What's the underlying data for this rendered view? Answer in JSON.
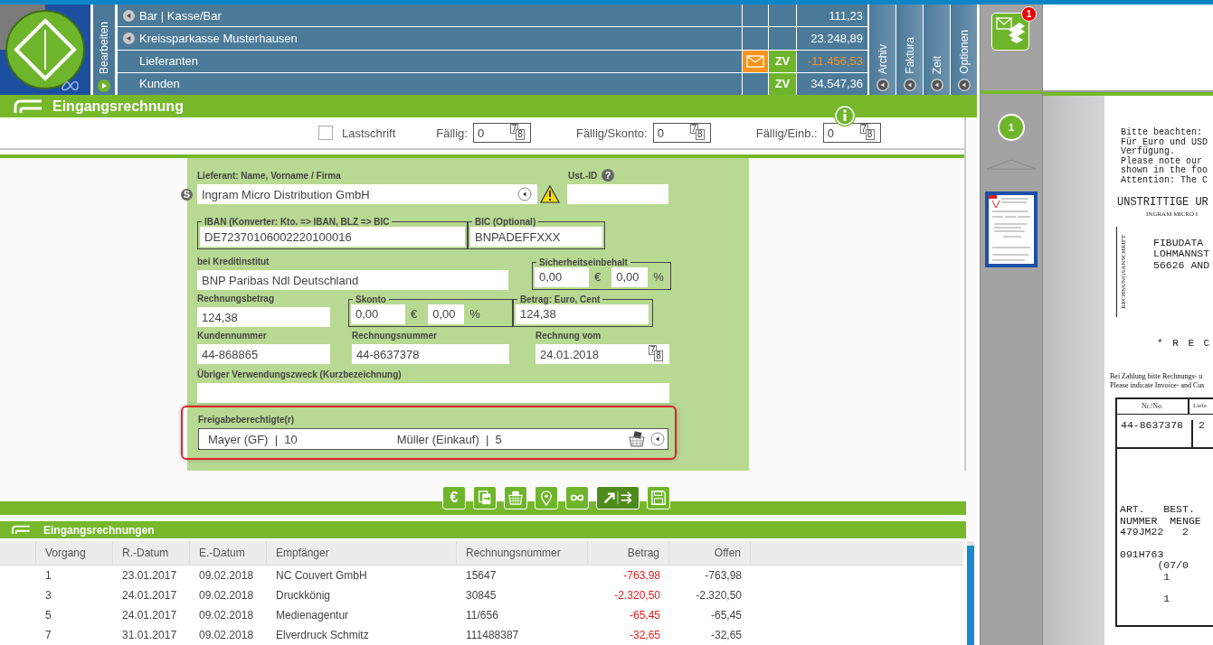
{
  "menu_tab": {
    "label": "Bearbeiten"
  },
  "accounts": [
    {
      "name": "Bar | Kasse/Bar",
      "expandable": true,
      "mail": false,
      "amount": "111,23",
      "negative": false
    },
    {
      "name": "Kreissparkasse Musterhausen",
      "expandable": true,
      "mail": false,
      "amount": "23.248,89",
      "negative": false
    },
    {
      "name": "Lieferanten",
      "expandable": false,
      "mail": true,
      "zv": "ZV",
      "amount": "-11.456,53",
      "negative": true
    },
    {
      "name": "Kunden",
      "expandable": false,
      "mail": false,
      "zv": "ZV",
      "amount": "34.547,36",
      "negative": false
    }
  ],
  "side_tabs": [
    {
      "label": "Archiv"
    },
    {
      "label": "Faktura"
    },
    {
      "label": "Zeit"
    },
    {
      "label": "Optionen"
    }
  ],
  "title": "Eingangsrechnung",
  "filters": {
    "direct_debit": {
      "label": "Lastschrift",
      "checked": false
    },
    "due_dates": [
      {
        "label": "Fällig:",
        "value": "0",
        "calendar": [
          "7",
          "8"
        ]
      },
      {
        "label": "Fällig/Skonto:",
        "value": "0",
        "calendar": [
          "7",
          "8"
        ]
      },
      {
        "label": "Fällig/Einb.:",
        "value": "0",
        "calendar": [
          "7",
          "8"
        ]
      }
    ]
  },
  "form": {
    "supplier": {
      "label": "Lieferant: Name, Vorname / Firma",
      "badge": "S",
      "value": "Ingram Micro Distribution GmbH",
      "warning": true
    },
    "vat_id": {
      "label": "Ust.-ID",
      "help": "?"
    },
    "iban": {
      "label": "IBAN (Konverter: Kto. => IBAN, BLZ => BIC",
      "value": "DE72370106002220100016"
    },
    "bic": {
      "label": "BIC (Optional)",
      "value": "BNPADEFFXXX"
    },
    "bank": {
      "label": "bei Kreditinstitut",
      "value": "BNP Paribas Ndl Deutschland"
    },
    "retention": {
      "label": "Sicherheitseinbehalt",
      "amount": "0,00",
      "currency": "€",
      "percent": "0,00",
      "percent_sign": "%"
    },
    "invoice_amount": {
      "label": "Rechnungsbetrag",
      "value": "124,38"
    },
    "discount": {
      "label": "Skonto",
      "amount": "0,00",
      "currency": "€",
      "percent": "0,00",
      "percent_sign": "%"
    },
    "amount": {
      "label": "Betrag: Euro, Cent",
      "value": "124,38"
    },
    "customer_number": {
      "label": "Kundennummer",
      "value": "44-868865"
    },
    "invoice_number": {
      "label": "Rechnungsnummer",
      "value": "44-8637378"
    },
    "invoice_date": {
      "label": "Rechnung vom",
      "value": "24.01.2018",
      "calendar": [
        "7",
        "8"
      ]
    },
    "purpose": {
      "label": "Übriger Verwendungszweck (Kurzbezeichnung)"
    },
    "approvers": {
      "label": "Freigabeberechtigte(r)",
      "highlighted": true,
      "entries": [
        "Mayer (GF)  |  10",
        "Müller (Einkauf)  |  5"
      ]
    }
  },
  "toolbar": [
    {
      "kind": "euro",
      "glyph": "€",
      "selected": false
    },
    {
      "kind": "copy",
      "selected": false
    },
    {
      "kind": "basket",
      "selected": false
    },
    {
      "kind": "pin",
      "selected": false
    },
    {
      "kind": "infinity",
      "selected": false
    },
    {
      "kind": "transfer",
      "selected": true
    },
    {
      "kind": "save",
      "selected": false
    }
  ],
  "list": {
    "title": "Eingangsrechnungen",
    "columns": [
      "Vorgang",
      "R.-Datum",
      "E.-Datum",
      "Empfänger",
      "Rechnungsnummer",
      "Betrag",
      "Offen"
    ],
    "rows": [
      {
        "cells": [
          "1",
          "23.01.2017",
          "09.02.2018",
          "NC Couvert GmbH",
          "15647",
          "-763,98",
          "-763,98"
        ],
        "negative": true
      },
      {
        "cells": [
          "3",
          "24.01.2017",
          "09.02.2018",
          "Druckkönig",
          "30845",
          "-2.320,50",
          "-2.320,50"
        ],
        "negative": true
      },
      {
        "cells": [
          "5",
          "24.01.2017",
          "09.02.2018",
          "Medienagentur",
          "11/656",
          "-65,45",
          "-65,45"
        ],
        "negative": true
      },
      {
        "cells": [
          "7",
          "31.01.2017",
          "09.02.2018",
          "Elverdruck Schmitz",
          "111488387",
          "-32,65",
          "-32,65"
        ],
        "negative": true
      }
    ]
  },
  "inbox": {
    "badge": "1"
  },
  "pages": {
    "current": "1"
  },
  "preview": {
    "notice": [
      "Bitte beachten:",
      "Für Euro und USD",
      "Verfügung.",
      "Please note our",
      "shown in the foo",
      "Attention: The C"
    ],
    "heading": "UNSTRITTIGE UR",
    "subheading": "INGRAM MICRO I",
    "address_label": "RECHNUNGSANSCHRIFT",
    "address": [
      "FIBUDATA",
      "LOHMANNST",
      "56626 AND"
    ],
    "banner": "* R E C",
    "payment_note": [
      "Bei Zahlung bitte Rechnungs- u",
      "Please indicate Invoice- and Cus"
    ],
    "table_headers": [
      "Nr./No.",
      "Liefe"
    ],
    "table_values": [
      "44-8637378",
      "2"
    ],
    "items": [
      [
        "ART.   BEST.",
        "NUMMER  MENGE",
        "479JM22   2"
      ],
      [
        "091H763",
        "      (07/0",
        "       1"
      ],
      [
        "       1"
      ]
    ]
  }
}
